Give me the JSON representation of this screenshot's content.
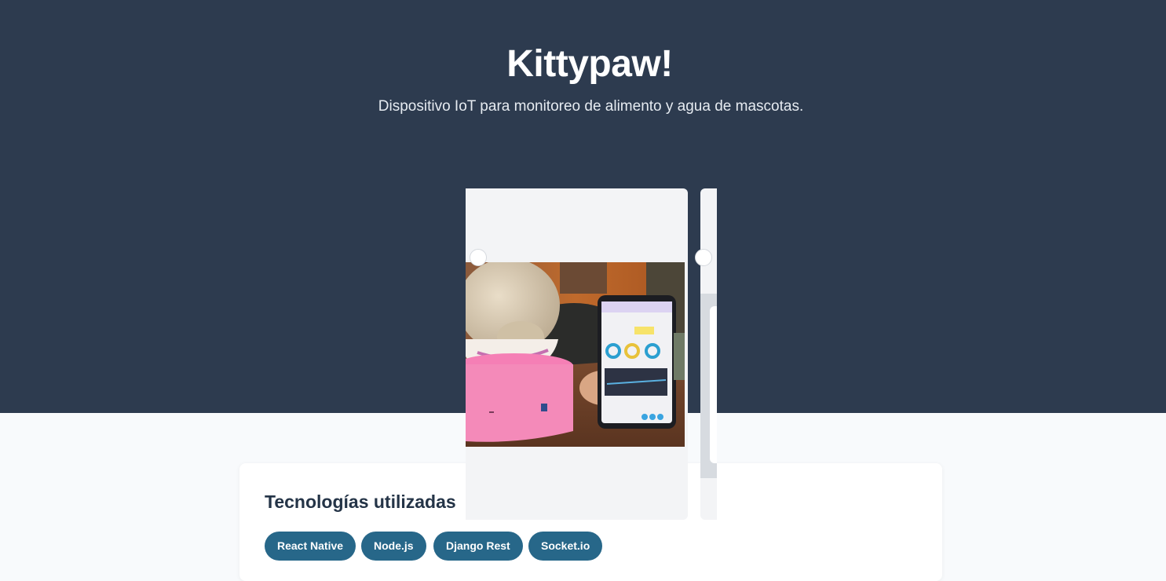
{
  "hero": {
    "title": "Kittypaw!",
    "subtitle": "Dispositivo IoT para monitoreo de alimento y agua de mascotas.",
    "background": "#2d3b4f"
  },
  "carousel": {
    "photo": "cat-eating-with-phone-app-photo",
    "indicators": [
      "carousel-dot",
      "carousel-dot"
    ]
  },
  "technologies": {
    "title": "Tecnologías utilizadas",
    "tags": [
      "React Native",
      "Node.js",
      "Django Rest",
      "Socket.io"
    ],
    "tag_color": "#276789"
  }
}
